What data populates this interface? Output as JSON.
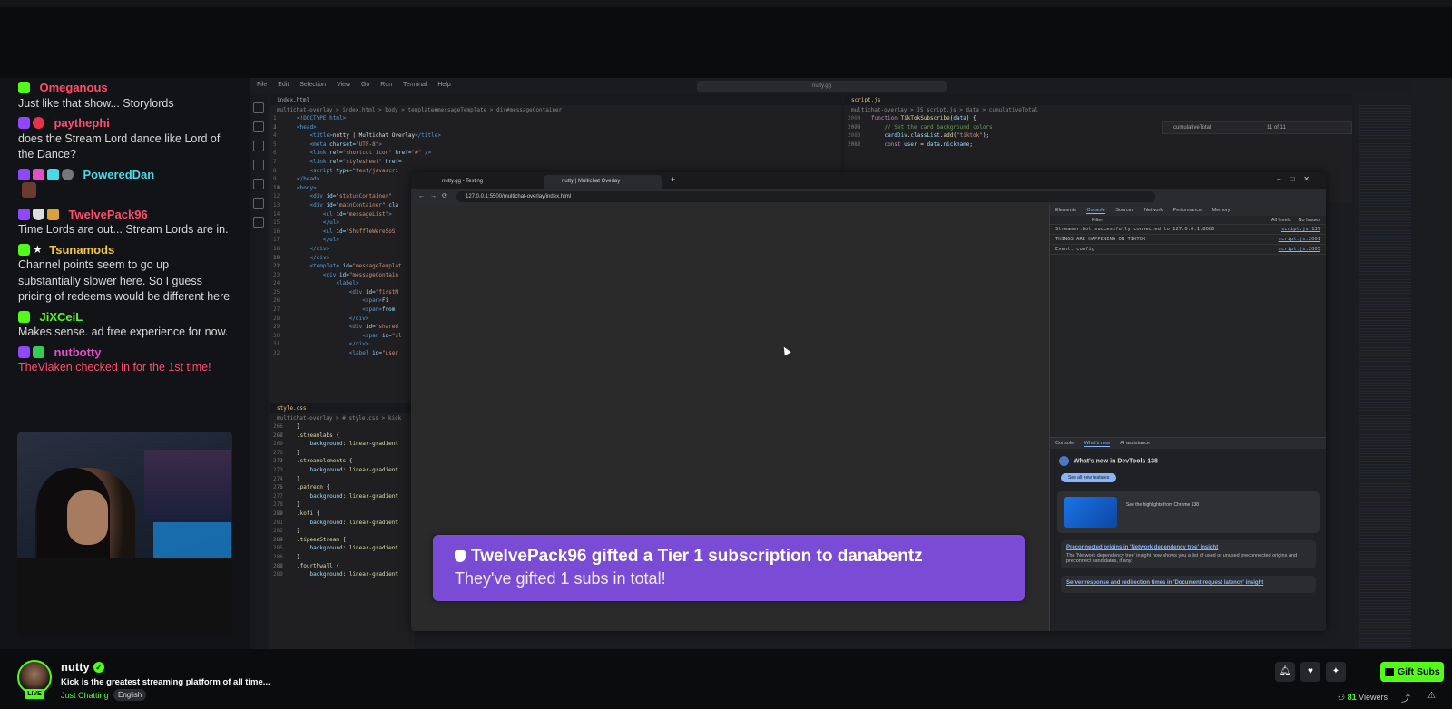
{
  "chat": {
    "messages": [
      {
        "user": "Omeganous",
        "color": "#ff4d6d",
        "text": "Just like that show... Storylords",
        "badges": [
          "kick"
        ]
      },
      {
        "user": "paythephi",
        "color": "#ff4d6d",
        "text": "does the Stream Lord dance like Lord of the Dance?",
        "badges": [
          "twitch",
          "heart"
        ]
      },
      {
        "user": "PoweredDan",
        "color": "#49d8e6",
        "text": "",
        "badges": [
          "twitch",
          "pink",
          "cyan",
          "grey"
        ]
      },
      {
        "user": "TwelvePack96",
        "color": "#ff4d6d",
        "text": "Time Lords are out... Stream Lords are in.",
        "badges": [
          "twitch",
          "shield",
          "gold"
        ]
      },
      {
        "user": "Tsunamods",
        "color": "#f3c94a",
        "text": "Channel points seem to go up substantially slower here. So I guess pricing of redeems would be different here",
        "badges": [
          "kick",
          "star"
        ]
      },
      {
        "user": "JiXCeiL",
        "color": "#53fc18",
        "text": "Makes sense. ad free experience for now.",
        "badges": [
          "kick"
        ]
      },
      {
        "user": "nutbotty",
        "color": "#e24fc9",
        "text": "",
        "badges": [
          "twitch",
          "green"
        ]
      }
    ],
    "system_message": "TheVlaken checked in for the 1st time!"
  },
  "desktop": {
    "menu": [
      "File",
      "Edit",
      "Selection",
      "View",
      "Go",
      "Run",
      "Terminal",
      "Help"
    ],
    "search": "nutty.gg",
    "editor_tab": "index.html",
    "editor_crumbs": "multichat-overlay > index.html > body > template#messageTemplate > div#messageContainer",
    "style_tab": "style.css",
    "style_crumbs": "multichat-overlay > # style.css > kick",
    "script_tab": "script.js",
    "script_crumbs": "multichat-overlay > JS script.js > data > cumulativeTotal",
    "find_text": "cumulativeTotal",
    "find_count": "11 of 11"
  },
  "browser": {
    "tabs": [
      "nutty.gg - Testing",
      "nutty | Multichat Overlay"
    ],
    "url": "127.0.0.1:5500/multichat-overlay/index.html"
  },
  "alert": {
    "title": "TwelvePack96 gifted a Tier 1 subscription to danabentz",
    "subtitle": "They've gifted 1 subs in total!"
  },
  "devtools": {
    "tabs": [
      "Elements",
      "Console",
      "Sources",
      "Network",
      "Performance",
      "Memory"
    ],
    "active_tab": "Console",
    "filter_placeholder": "Filter",
    "levels": "All levels",
    "issues": "No Issues",
    "console_lines": [
      {
        "text": "Streamer.bot successfully connected to 127.0.0.1:8080",
        "src": "script.js:139"
      },
      {
        "text": "THINGS ARE HAPPENING ON TIKTOK",
        "src": "script.js:2001"
      },
      {
        "text": "Event: config",
        "src": "script.js:2005"
      }
    ],
    "drawer_tabs": [
      "Console",
      "What's new",
      "AI assistance"
    ],
    "whats_new_title": "What's new in DevTools 138",
    "whats_new_button": "See all new features",
    "highlight_caption": "See the highlights from Chrome 138",
    "items": [
      {
        "heading": "Preconnected origins in 'Network dependency tree' insight",
        "body": "The 'Network dependency tree' insight now shows you a list of used or unused preconnected origins and preconnect candidates, if any."
      },
      {
        "heading": "Server response and redirection times in 'Document request latency' insight",
        "body": ""
      }
    ]
  },
  "channel": {
    "name": "nutty",
    "live_label": "LIVE",
    "title": "Kick is the greatest streaming platform of all time...",
    "category": "Just Chatting",
    "language": "English",
    "viewers_count": "81",
    "viewers_label": "Viewers",
    "gift_label": "Gift Subs"
  },
  "icons": {
    "bell": "bell-icon",
    "heart": "heart-icon",
    "sparkle": "sparkle-icon",
    "gift": "gift-icon",
    "share": "share-icon",
    "report": "report-icon"
  },
  "colors": {
    "kick_green": "#53fc18",
    "alert_purple": "#7a4bd4",
    "background": "#0b0c0e"
  }
}
